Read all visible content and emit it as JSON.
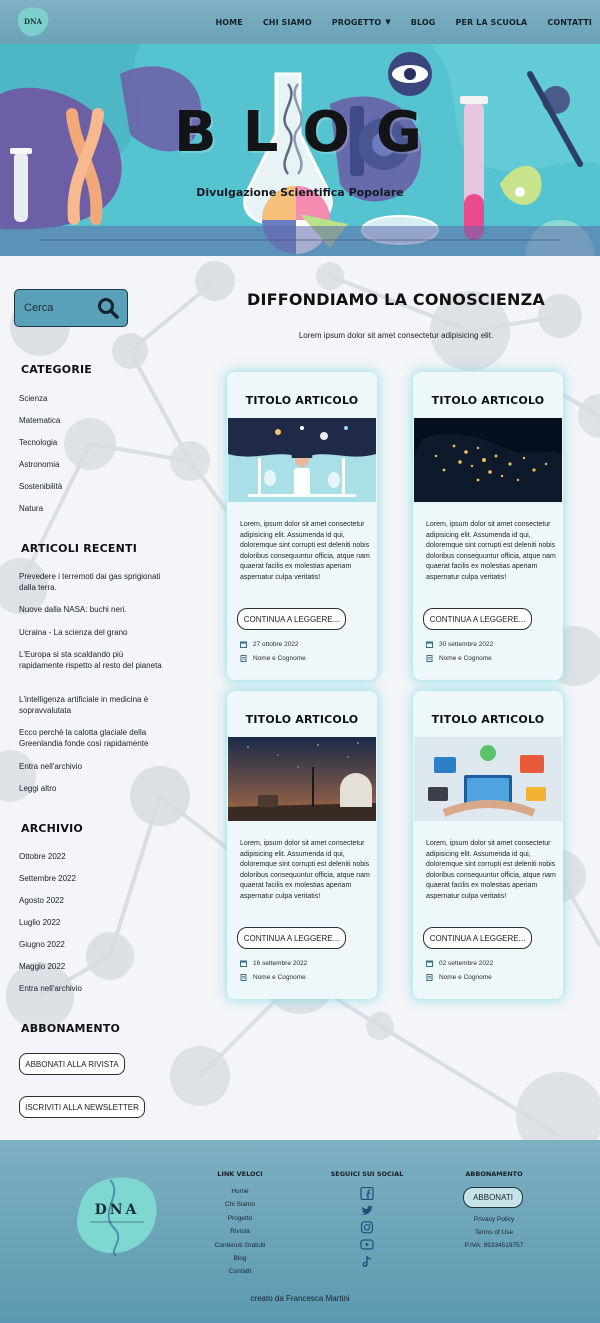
{
  "logo": {
    "text": "DNA"
  },
  "nav": {
    "items": [
      "HOME",
      "CHI SIAMO",
      "PROGETTO",
      "BLOG",
      "PER LA SCUOLA",
      "CONTATTI"
    ]
  },
  "hero": {
    "title": "BLOG",
    "subtitle": "Divulgazione Scientifica Popolare"
  },
  "search": {
    "placeholder": "Cerca"
  },
  "sidebar": {
    "categories_title": "CATEGORIE",
    "categories": [
      "Scienza",
      "Matematica",
      "Tecnologia",
      "Astronomia",
      "Sostenibilità",
      "Natura"
    ],
    "recent_title": "ARTICOLI RECENTI",
    "recent": [
      "Prevedere i terremoti dai gas sprigionati dalla terra.",
      "Nuove dalla NASA: buchi neri.",
      "Ucraina - La scienza del grano",
      "L'Europa si sta scaldando più rapidamente rispetto al resto del pianeta",
      "L'intelligenza artificiale in medicina è sopravvalutata",
      "Ecco perchè la calotta glaciale della Greenlandia fonde così rapidamente",
      "Entra nell'archivio",
      "Leggi altro"
    ],
    "archive_title": "ARCHIVIO",
    "archive": [
      "Ottobre 2022",
      "Settembre 2022",
      "Agosto 2022",
      "Luglio 2022",
      "Giugno 2022",
      "Maggio 2022",
      "Entra nell'archivio"
    ],
    "subscription_title": "ABBONAMENTO",
    "subscribe_label": "ABBONATI ALLA RIVISTA",
    "newsletter_label": "ISCRIVITI ALLA NEWSLETTER"
  },
  "main": {
    "title": "DIFFONDIAMO LA CONOSCIENZA",
    "intro": "Lorem ipsum dolor sit amet consectetur adipisicing elit."
  },
  "cards": [
    {
      "title": "TITOLO ARTICOLO",
      "text": "Lorem, ipsum dolor sit amet consectetur adipisicing elit. Assumenda id qui, doloremque sint corrupti est deleniti nobis doloribus consequuntur officia, atque nam quaerat facilis ex molestias aperiam aspernatur culpa veritatis!",
      "button": "CONTINUA A LEGGERE...",
      "date": "27 ottobre 2022",
      "author": "Nome e Cognome"
    },
    {
      "title": "TITOLO ARTICOLO",
      "text": "Lorem, ipsum dolor sit amet consectetur adipisicing elit. Assumenda id qui, doloremque sint corrupti est deleniti nobis doloribus consequuntur officia, atque nam quaerat facilis ex molestias aperiam aspernatur culpa veritatis!",
      "button": "CONTINUA A LEGGERE...",
      "date": "30 settembre 2022",
      "author": "Nome e Cognome"
    },
    {
      "title": "TITOLO ARTICOLO",
      "text": "Lorem, ipsum dolor sit amet consectetur adipisicing elit. Assumenda id qui, doloremque sint corrupti est deleniti nobis doloribus consequuntur officia, atque nam quaerat facilis ex molestias aperiam aspernatur culpa veritatis!",
      "button": "CONTINUA A LEGGERE...",
      "date": "16 settembre 2022",
      "author": "Nome e Cognome"
    },
    {
      "title": "TITOLO ARTICOLO",
      "text": "Lorem, ipsum dolor sit amet consectetur adipisicing elit. Assumenda id qui, doloremque sint corrupti est deleniti nobis doloribus consequuntur officia, atque nam quaerat facilis ex molestias aperiam aspernatur culpa veritatis!",
      "button": "CONTINUA A LEGGERE...",
      "date": "02 settembre 2022",
      "author": "Nome e Cognome"
    }
  ],
  "footer": {
    "logo_text": "DNA",
    "quick_links_title": "LINK VELOCI",
    "quick_links": [
      "Home",
      "Chi Siamo",
      "Progetto",
      "Rivista",
      "Contenuti Gratuiti",
      "Blog",
      "Contatti"
    ],
    "social_title": "SEGUICI SUI SOCIAL",
    "social": [
      "facebook-icon",
      "twitter-icon",
      "instagram-icon",
      "youtube-icon",
      "tiktok-icon"
    ],
    "subscription_title": "ABBONAMENTO",
    "subscribe_label": "ABBONATI",
    "privacy": "Privacy Policy",
    "terms": "Terms of Use",
    "vat": "P.IVA: 89334519757",
    "credit": "creato da Francesca Martini"
  },
  "colors": {
    "header": "#6aa2b6",
    "hero": "#55c3d0",
    "card_glow": "#8adbe6",
    "footer": "#5b9ab0"
  }
}
